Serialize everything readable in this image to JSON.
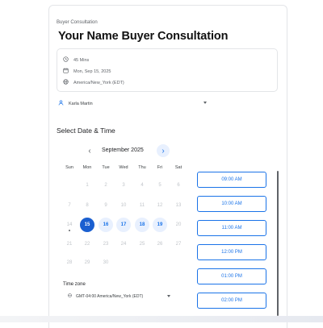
{
  "header": {
    "eyebrow": "Buyer Consultation",
    "title": "Your Name Buyer Consultation"
  },
  "details": {
    "duration": "45 Mins",
    "date": "Mon, Sep 15, 2025",
    "timezone": "America/New_York (EDT)"
  },
  "user": {
    "name": "Karla Martin"
  },
  "section_title": "Select Date & Time",
  "calendar": {
    "month": "September 2025",
    "weekdays": [
      "Sun",
      "Mon",
      "Tue",
      "Wed",
      "Thu",
      "Fri",
      "Sat"
    ],
    "weeks": [
      [
        "",
        "1",
        "2",
        "3",
        "4",
        "5",
        "6"
      ],
      [
        "7",
        "8",
        "9",
        "10",
        "11",
        "12",
        "13"
      ],
      [
        "14",
        "15",
        "16",
        "17",
        "18",
        "19",
        "20"
      ],
      [
        "21",
        "22",
        "23",
        "24",
        "25",
        "26",
        "27"
      ],
      [
        "28",
        "29",
        "30",
        "",
        "",
        "",
        ""
      ]
    ],
    "selected": "15",
    "available": [
      "16",
      "17",
      "18",
      "19"
    ],
    "today": "14"
  },
  "timezone_picker": {
    "label": "Time zone",
    "value": "GMT-04:00 America/New_York (EDT)"
  },
  "slots": [
    "09:00 AM",
    "10:00 AM",
    "11:00 AM",
    "12:00 PM",
    "01:00 PM",
    "02:00 PM"
  ],
  "colors": {
    "accent": "#1a73e8",
    "selected": "#1a5fd0",
    "available_bg": "#e8f0fe"
  }
}
